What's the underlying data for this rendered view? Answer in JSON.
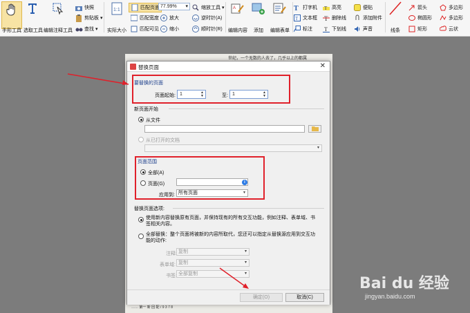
{
  "ribbon": {
    "hand_tool": "手形工具",
    "select_tool": "选取工具",
    "edit_annot_tool": "编辑注释工具",
    "snapshot": "快照",
    "clipboard": "剪贴板",
    "find": "查找",
    "actual_size": "实际大小",
    "fit_page": "匹配页面",
    "fit_width": "匹配宽度",
    "fit_visible": "匹配可见",
    "zoom_value": "77.99%",
    "zoom_tool": "缩放工具",
    "zoom_in": "放大",
    "zoom_out": "缩小",
    "rotate_left": "逆时针(A)",
    "rotate_right": "顺时针(R)",
    "edit_content": "编辑内容",
    "add": "添加",
    "edit_form": "编辑表单",
    "typewriter": "打字机",
    "textbox": "文本框",
    "callout": "标注",
    "highlight": "高亮",
    "strikeout": "删除线",
    "underline": "下划线",
    "sticky": "便贴",
    "attach": "添加附件",
    "sound": "声音",
    "line": "线条",
    "arrow": "箭头",
    "ellipse": "椭圆形",
    "rectangle": "矩形",
    "polygon": "多边形",
    "polyline": "多边形",
    "cloud": "云状"
  },
  "doc": {
    "page_top_text": "世纪，一个无数的人去了，几乎以上的都属",
    "page_bottom_text": "……  第一 新  回  配 / 9       3          7          8"
  },
  "dialog": {
    "title": "替换页面",
    "pages_to_replace_title": "要替换的页面",
    "page_from_label": "页面起始:",
    "page_from_value": "1",
    "to_label": "至:",
    "to_value": "1",
    "new_pages_title": "新页面开始",
    "from_file": "从文件",
    "from_open_doc": "从已打开的文档",
    "page_range_title": "页面范围",
    "all_label": "全部(A)",
    "pages_label": "页面(G)",
    "apply_to_label": "应用到:",
    "apply_to_value": "所有页面",
    "options_title": "替换页面选项:",
    "option1": "使用新内容替换原有页面，并保持现有的所有交互功能，例如注释、表单域、书签相关内容。",
    "option2": "全部替换：整个页面将被新的内容所取代，您还可以指定从替换源应用到交互功能的动作:",
    "comments_label": "注释:",
    "comments_value": "复制",
    "form_label": "表单域:",
    "form_value": "复制",
    "bookmark_label": "书签:",
    "bookmark_value": "全部复制",
    "ok": "确定(O)",
    "cancel": "取消(C)"
  },
  "watermark": {
    "brand": "Bai du 经验",
    "url": "jingyan.baidu.com"
  },
  "colors": {
    "annotation_red": "#e0202a",
    "section_blue": "#1a3d8a"
  }
}
